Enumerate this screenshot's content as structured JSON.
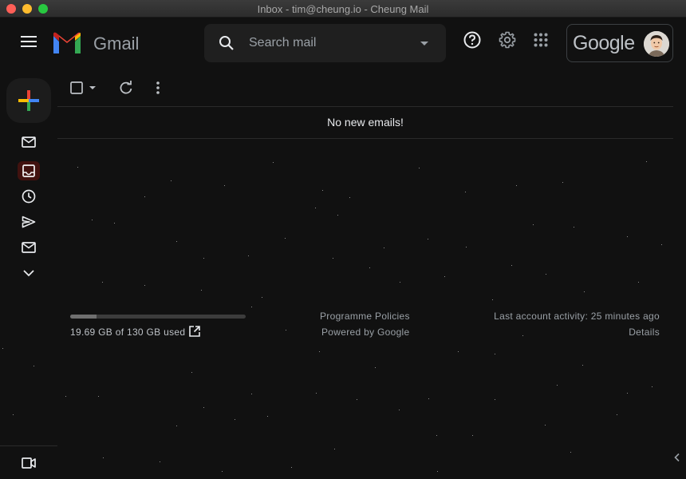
{
  "window": {
    "title": "Inbox - tim@cheung.io - Cheung Mail"
  },
  "header": {
    "brand": "Gmail",
    "search_placeholder": "Search mail",
    "account_wordmark": "Google"
  },
  "main": {
    "empty_message": "No new emails!"
  },
  "footer": {
    "storage_text": "19.69 GB of 130 GB used",
    "storage_fraction": 0.15,
    "policies_link": "Programme Policies",
    "powered_by": "Powered by Google",
    "last_activity": "Last account activity: 25 minutes ago",
    "details_link": "Details"
  },
  "colors": {
    "background": "#111111",
    "gmail_red": "#ea4335",
    "gmail_blue": "#4285f4",
    "gmail_green": "#34a853",
    "gmail_yellow": "#fbbc04",
    "active_nav_bg": "#41120f"
  },
  "icons": [
    "menu-icon",
    "gmail-logo",
    "search-icon",
    "search-options-icon",
    "help-icon",
    "gear-icon",
    "apps-icon",
    "avatar",
    "compose-plus-icon",
    "mail-icon",
    "inbox-icon",
    "clock-icon",
    "send-icon",
    "mail-icon",
    "chevron-down-icon",
    "video-icon",
    "checkbox-icon",
    "refresh-icon",
    "more-vert-icon",
    "external-link-icon",
    "chevron-left-icon"
  ]
}
